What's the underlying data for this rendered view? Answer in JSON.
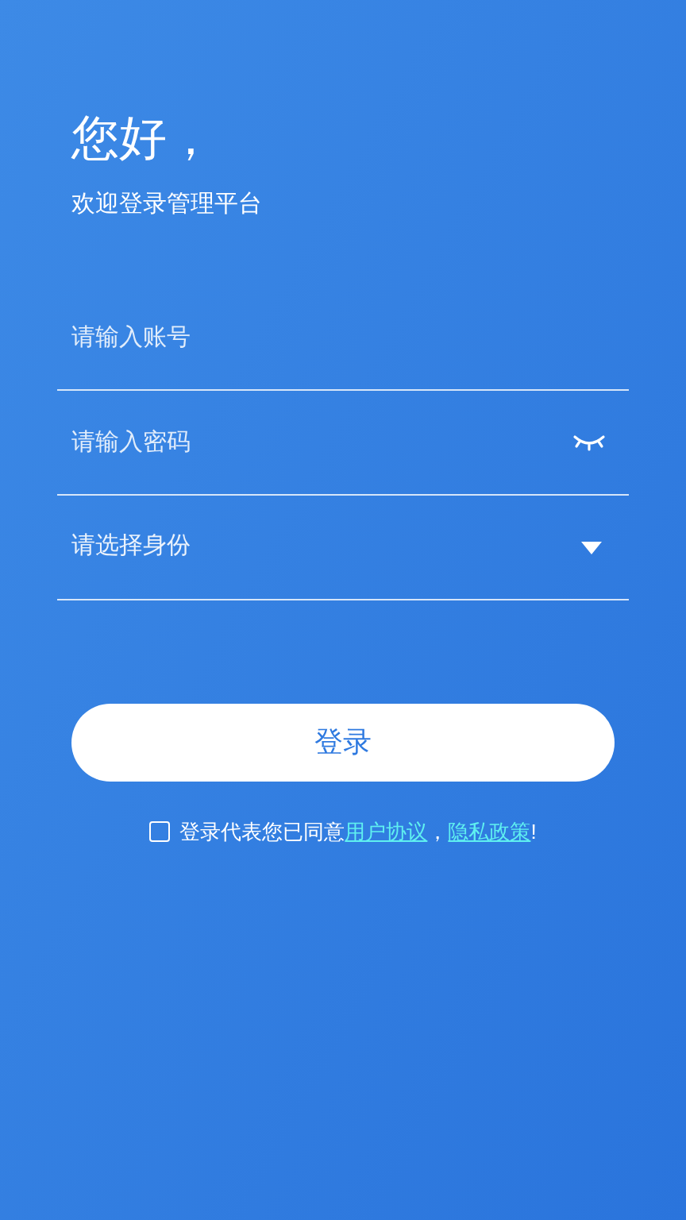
{
  "greeting": "您好，",
  "subtitle": "欢迎登录管理平台",
  "fields": [
    {
      "kind": "text",
      "placeholder": "请输入账号"
    },
    {
      "kind": "password",
      "placeholder": "请输入密码"
    },
    {
      "kind": "select",
      "placeholder": "请选择身份"
    }
  ],
  "login_button": "登录",
  "agreement": {
    "checked": false,
    "text": "登录代表您已同意",
    "links": [
      "用户协议",
      "隐私政策"
    ],
    "separator": "，",
    "end": "!"
  }
}
